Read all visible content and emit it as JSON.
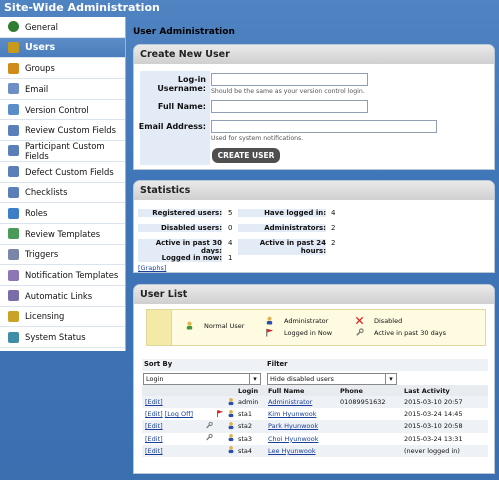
{
  "page_title": "Site-Wide Administration",
  "sidebar": {
    "items": [
      {
        "label": "General",
        "icon": "globe-icon",
        "color": "#2e7d32"
      },
      {
        "label": "Users",
        "icon": "user-icon",
        "color": "#c79a1e",
        "active": true
      },
      {
        "label": "Groups",
        "icon": "group-icon",
        "color": "#d08b1a"
      },
      {
        "label": "Email",
        "icon": "email-icon",
        "color": "#6e8fc6"
      },
      {
        "label": "Version Control",
        "icon": "version-control-icon",
        "color": "#5a8ec8"
      },
      {
        "label": "Review Custom Fields",
        "icon": "custom-fields-icon",
        "color": "#5b7fb8"
      },
      {
        "label": "Participant Custom Fields",
        "icon": "custom-fields-icon",
        "color": "#5b7fb8"
      },
      {
        "label": "Defect Custom Fields",
        "icon": "custom-fields-icon",
        "color": "#5b7fb8"
      },
      {
        "label": "Checklists",
        "icon": "checklist-icon",
        "color": "#5b7fb8"
      },
      {
        "label": "Roles",
        "icon": "roles-icon",
        "color": "#3d7fc7"
      },
      {
        "label": "Review Templates",
        "icon": "template-icon",
        "color": "#4a9a5a"
      },
      {
        "label": "Triggers",
        "icon": "trigger-icon",
        "color": "#7a86a8"
      },
      {
        "label": "Notification Templates",
        "icon": "notification-icon",
        "color": "#8c76b6"
      },
      {
        "label": "Automatic Links",
        "icon": "link-icon",
        "color": "#7a6da8"
      },
      {
        "label": "Licensing",
        "icon": "license-icon",
        "color": "#c9a227"
      },
      {
        "label": "System Status",
        "icon": "status-icon",
        "color": "#3f8ea8"
      }
    ]
  },
  "main": {
    "title": "User Administration",
    "create": {
      "header": "Create New User",
      "username_label": "Log-in Username:",
      "username_value": "",
      "username_hint": "Should be the same as your version control login.",
      "fullname_label": "Full Name:",
      "fullname_value": "",
      "email_label": "Email Address:",
      "email_value": "",
      "email_hint": "Used for system notifications.",
      "button": "CREATE USER"
    },
    "stats": {
      "header": "Statistics",
      "registered_label": "Registered users:",
      "registered": "5",
      "logged_in_label": "Have logged in:",
      "logged_in": "4",
      "disabled_label": "Disabled users:",
      "disabled": "0",
      "admins_label": "Administrators:",
      "admins": "2",
      "active30_label": "Active in past 30 days:",
      "active30": "4",
      "active24_label": "Active in past 24 hours:",
      "active24": "2",
      "now_label": "Logged in now:",
      "now": "1",
      "graphs_link": "[Graphs]"
    },
    "userlist": {
      "header": "User List",
      "legend": {
        "normal": "Normal User",
        "admin": "Administrator",
        "logged": "Logged in Now",
        "disabled": "Disabled",
        "active": "Active in past 30 days"
      },
      "sort_label": "Sort By",
      "sort_value": "Login",
      "filter_label": "Filter",
      "filter_value": "Hide disabled users",
      "columns": [
        "Login",
        "Full Name",
        "Phone",
        "Last Activity"
      ],
      "rows": [
        {
          "actions": "[Edit]",
          "logoff": "",
          "wrench": false,
          "flag": false,
          "login": "admin",
          "name": "Administrator",
          "phone": "01089951632",
          "last": "2015-03-10 20:57"
        },
        {
          "actions": "[Edit]",
          "logoff": "[Log Off]",
          "wrench": false,
          "flag": true,
          "login": "sta1",
          "name": "Kim Hyunwook",
          "phone": "",
          "last": "2015-03-24 14:45"
        },
        {
          "actions": "[Edit]",
          "logoff": "",
          "wrench": true,
          "flag": false,
          "login": "sta2",
          "name": "Park Hyunwook",
          "phone": "",
          "last": "2015-03-10 20:58"
        },
        {
          "actions": "[Edit]",
          "logoff": "",
          "wrench": true,
          "flag": false,
          "login": "sta3",
          "name": "Choi Hyunwook",
          "phone": "",
          "last": "2015-03-24 13:31"
        },
        {
          "actions": "[Edit]",
          "logoff": "",
          "wrench": false,
          "flag": false,
          "login": "sta4",
          "name": "Lee Hyunwook",
          "phone": "",
          "last": "(never logged in)"
        }
      ]
    }
  }
}
